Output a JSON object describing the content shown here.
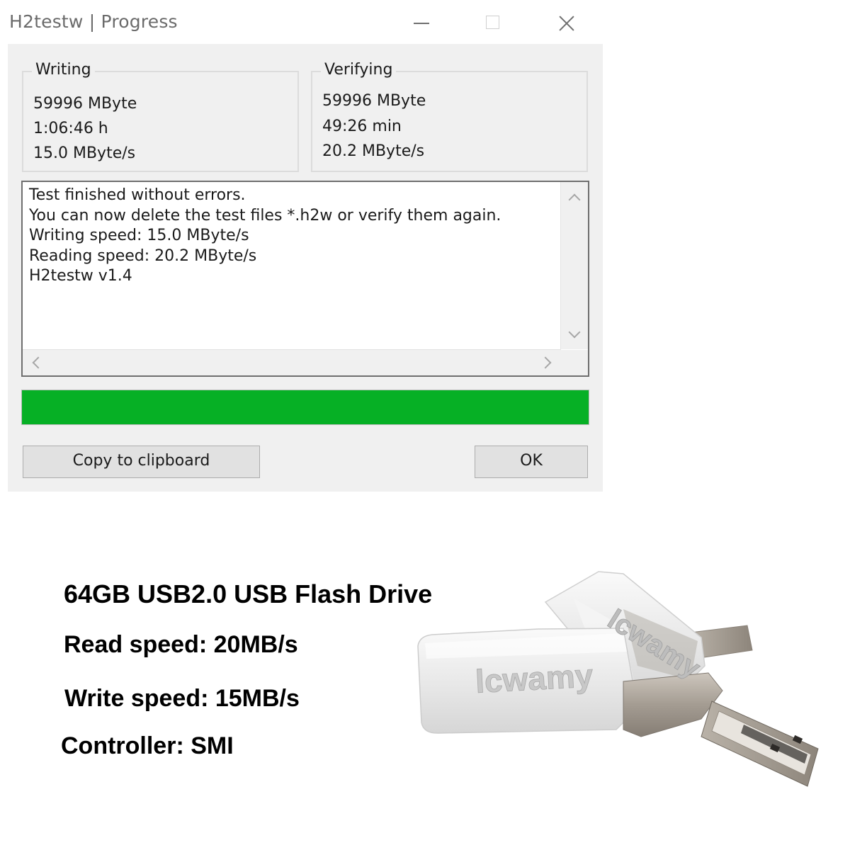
{
  "window": {
    "title": "H2testw | Progress",
    "controls": [
      "minimize",
      "maximize",
      "close"
    ]
  },
  "writing": {
    "legend": "Writing",
    "size": "59996 MByte",
    "time": "1:06:46 h",
    "speed": "15.0 MByte/s"
  },
  "verifying": {
    "legend": "Verifying",
    "size": "59996 MByte",
    "time": "49:26 min",
    "speed": "20.2 MByte/s"
  },
  "log": {
    "lines": [
      "Test finished without errors.",
      "You can now delete the test files *.h2w or verify them again.",
      "Writing speed: 15.0 MByte/s",
      "Reading speed: 20.2 MByte/s",
      "H2testw v1.4"
    ]
  },
  "progress": {
    "fraction": 1.0,
    "color": "#06b025"
  },
  "buttons": {
    "copy": "Copy to clipboard",
    "ok": "OK"
  },
  "product": {
    "specs": [
      "64GB USB2.0 USB Flash Drive",
      "Read speed: 20MB/s",
      "Write speed: 15MB/s",
      "Controller: SMI"
    ],
    "brand_engraving": "lcwamy"
  }
}
